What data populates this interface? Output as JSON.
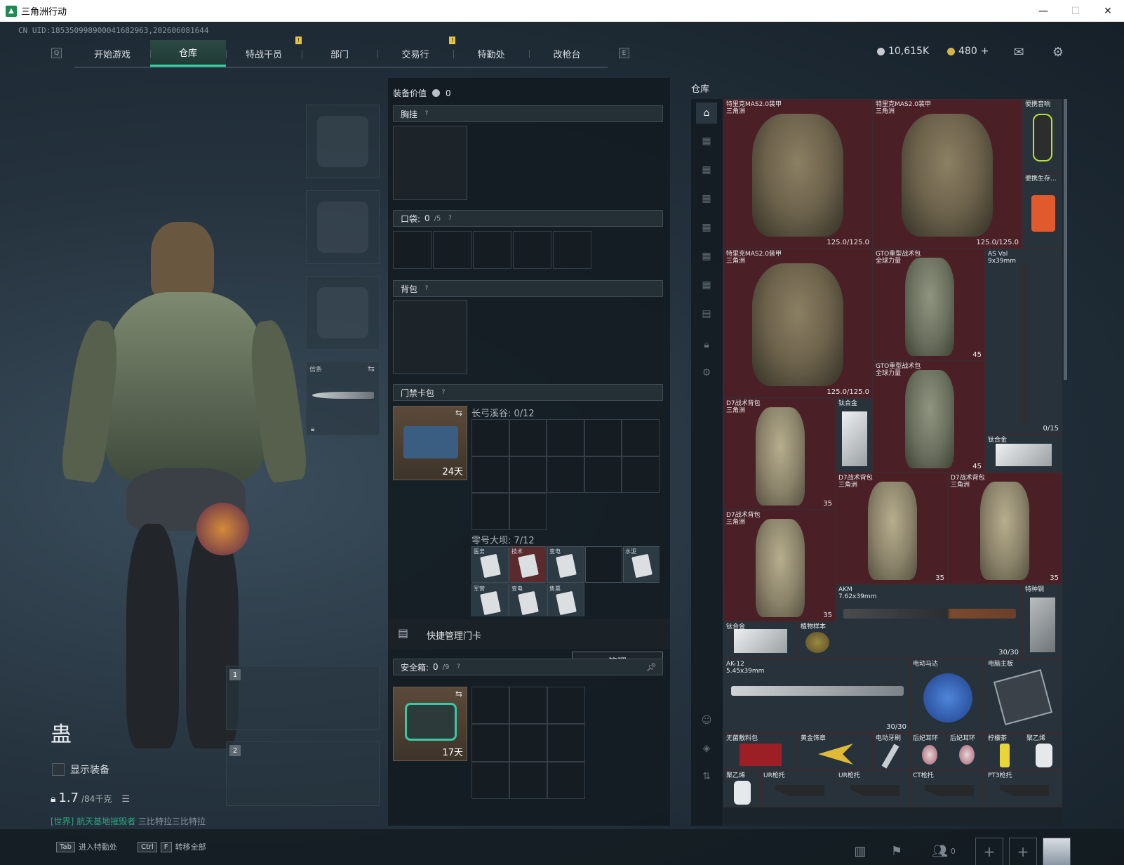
{
  "window": {
    "title": "三角洲行动",
    "min": "—",
    "max": "☐",
    "close": "✕"
  },
  "uid": "CN UID:1853509989000416829​63,202606081644",
  "nav": {
    "q_key": "Q",
    "e_key": "E",
    "tabs": [
      {
        "label": "开始游戏"
      },
      {
        "label": "仓库"
      },
      {
        "label": "特战干员"
      },
      {
        "label": "部门"
      },
      {
        "label": "交易行"
      },
      {
        "label": "特勤处"
      },
      {
        "label": "改枪台"
      }
    ],
    "badge": "!"
  },
  "currency": {
    "coins": "10,615K",
    "gold": "480",
    "plus": "+"
  },
  "character": {
    "name": "蛊",
    "show_equip": "显示装备",
    "weight": "1.7",
    "weight_max": "/84千克",
    "chat_channel": "[世界]",
    "chat_user": "航天基地摧毁者",
    "chat_text": "三比特拉三比特拉"
  },
  "equip": {
    "melee_label": "信条",
    "slot1": "1",
    "slot2": "2"
  },
  "loadout": {
    "value_label": "装备价值",
    "value": "0",
    "chest": "胸挂",
    "pocket": "口袋:",
    "pocket_count": "0",
    "pocket_max": "/5",
    "backpack": "背包",
    "keycase": "门禁卡包",
    "keycase_timer": "24天",
    "map1": "长弓溪谷: 0/12",
    "map2": "零号大坝: 7/12",
    "manage_label": "快捷管理门卡",
    "manage_btn": "管理",
    "safebox": "安全箱:",
    "safebox_count": "0",
    "safebox_max": "/9",
    "safebox_timer": "17天",
    "q": "?",
    "mini_tags": [
      "医务",
      "技术",
      "变电",
      "水泥",
      "军营",
      "变电",
      "售票"
    ]
  },
  "warehouse": {
    "title": "仓库",
    "items": [
      {
        "name": "特里克MAS2.0装甲\n三角洲",
        "value": "125.0/125.0"
      },
      {
        "name": "特里克MAS2.0装甲\n三角洲",
        "value": "125.0/125.0"
      },
      {
        "name": "便携音响",
        "value": ""
      },
      {
        "name": "便携生存...",
        "value": ""
      },
      {
        "name": "特里克MAS2.0装甲\n三角洲",
        "value": "125.0/125.0"
      },
      {
        "name": "GTO重型战术包\n全球力量",
        "value": "45"
      },
      {
        "name": "AS Val\n9x39mm",
        "value": "0/15"
      },
      {
        "name": "GTO重型战术包\n全球力量",
        "value": "45"
      },
      {
        "name": "D7战术背包\n三角洲",
        "value": "35"
      },
      {
        "name": "钛合金",
        "value": ""
      },
      {
        "name": "钛合金",
        "value": ""
      },
      {
        "name": "D7战术背包\n三角洲",
        "value": "35"
      },
      {
        "name": "D7战术背包\n三角洲",
        "value": "35"
      },
      {
        "name": "D7战术背包\n三角洲",
        "value": "35"
      },
      {
        "name": "AKM\n7.62x39mm",
        "value": "30/30"
      },
      {
        "name": "特种钢",
        "value": ""
      },
      {
        "name": "钛合金",
        "value": ""
      },
      {
        "name": "植物样本",
        "value": ""
      },
      {
        "name": "AK-12\n5.45x39mm",
        "value": "30/30"
      },
      {
        "name": "电动马达",
        "value": ""
      },
      {
        "name": "电脑主板",
        "value": ""
      },
      {
        "name": "无菌敷料包",
        "value": ""
      },
      {
        "name": "黄金饰章",
        "value": ""
      },
      {
        "name": "电动牙刷",
        "value": ""
      },
      {
        "name": "后妃耳环",
        "value": ""
      },
      {
        "name": "后妃耳环",
        "value": ""
      },
      {
        "name": "柠檬茶",
        "value": ""
      },
      {
        "name": "聚乙烯",
        "value": ""
      },
      {
        "name": "聚乙烯",
        "value": ""
      },
      {
        "name": "UR枪托",
        "value": ""
      },
      {
        "name": "UR枪托",
        "value": ""
      },
      {
        "name": "CT枪托",
        "value": ""
      },
      {
        "name": "PT3枪托",
        "value": ""
      }
    ]
  },
  "bottom": {
    "tab_key": "Tab",
    "tab_label": "进入特勤处",
    "ctrl_key": "Ctrl",
    "f_key": "F",
    "ctrl_label": "转移全部",
    "friends": "0",
    "plus": "+"
  }
}
